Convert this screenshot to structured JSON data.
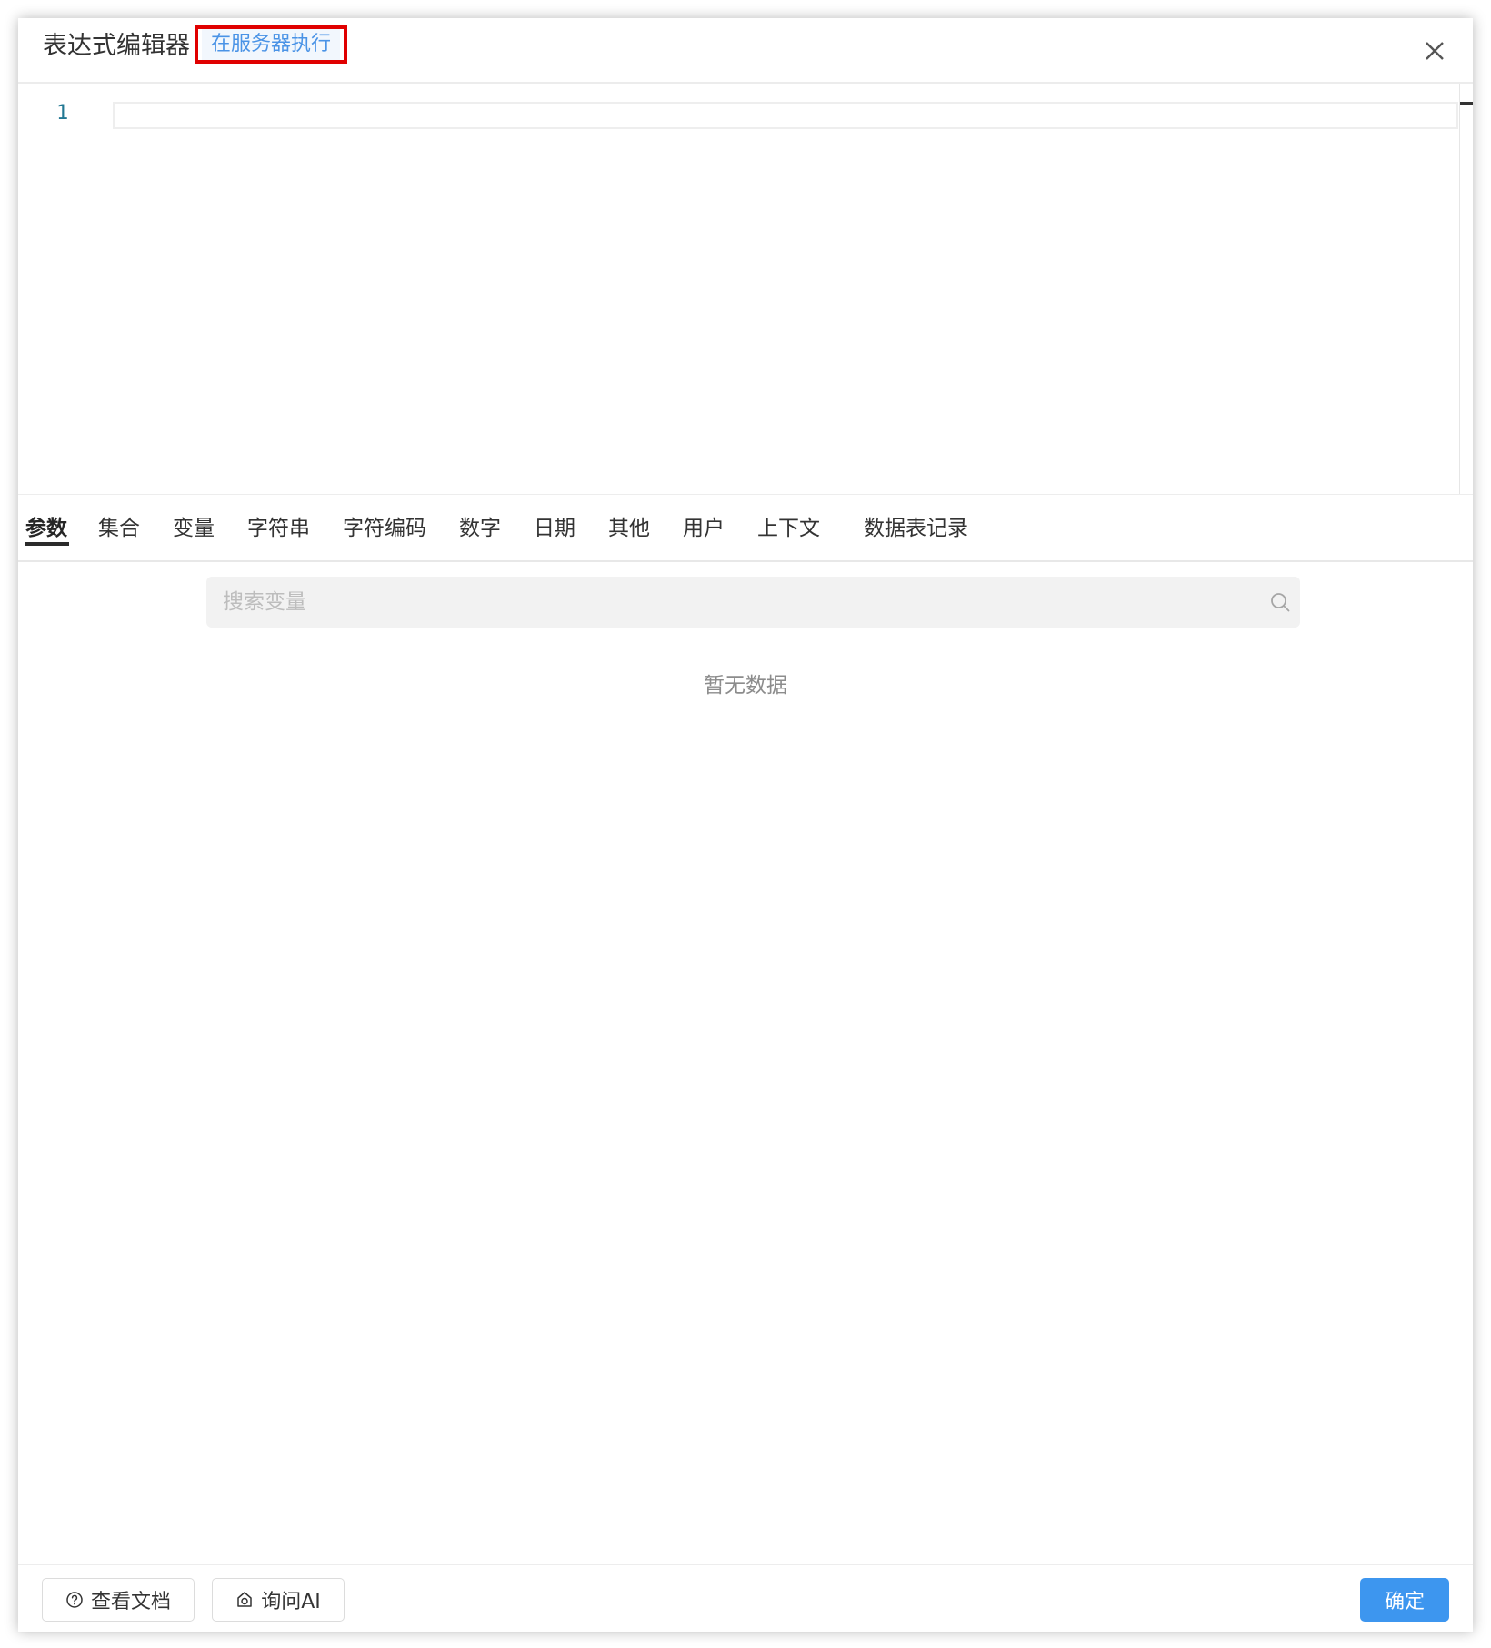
{
  "header": {
    "title": "表达式编辑器",
    "server_button_label": "在服务器执行"
  },
  "editor": {
    "line_numbers": [
      "1"
    ],
    "content": ""
  },
  "tabs": [
    {
      "label": "参数",
      "active": true
    },
    {
      "label": "集合",
      "active": false
    },
    {
      "label": "变量",
      "active": false
    },
    {
      "label": "字符串",
      "active": false
    },
    {
      "label": "字符编码",
      "active": false
    },
    {
      "label": "数字",
      "active": false
    },
    {
      "label": "日期",
      "active": false
    },
    {
      "label": "其他",
      "active": false
    },
    {
      "label": "用户",
      "active": false
    },
    {
      "label": "上下文",
      "active": false
    },
    {
      "label": "数据表记录",
      "active": false
    }
  ],
  "search": {
    "placeholder": "搜索变量",
    "value": ""
  },
  "empty_state": {
    "text": "暂无数据"
  },
  "footer": {
    "docs_button_label": "查看文档",
    "ai_button_label": "询问AI",
    "confirm_button_label": "确定"
  },
  "colors": {
    "accent": "#3d96ef",
    "link": "#4a93e6",
    "highlight_border": "#e00000"
  },
  "icons": {
    "close": "close-icon",
    "search": "search-icon",
    "docs": "question-circle-icon",
    "ai": "robot-icon"
  }
}
